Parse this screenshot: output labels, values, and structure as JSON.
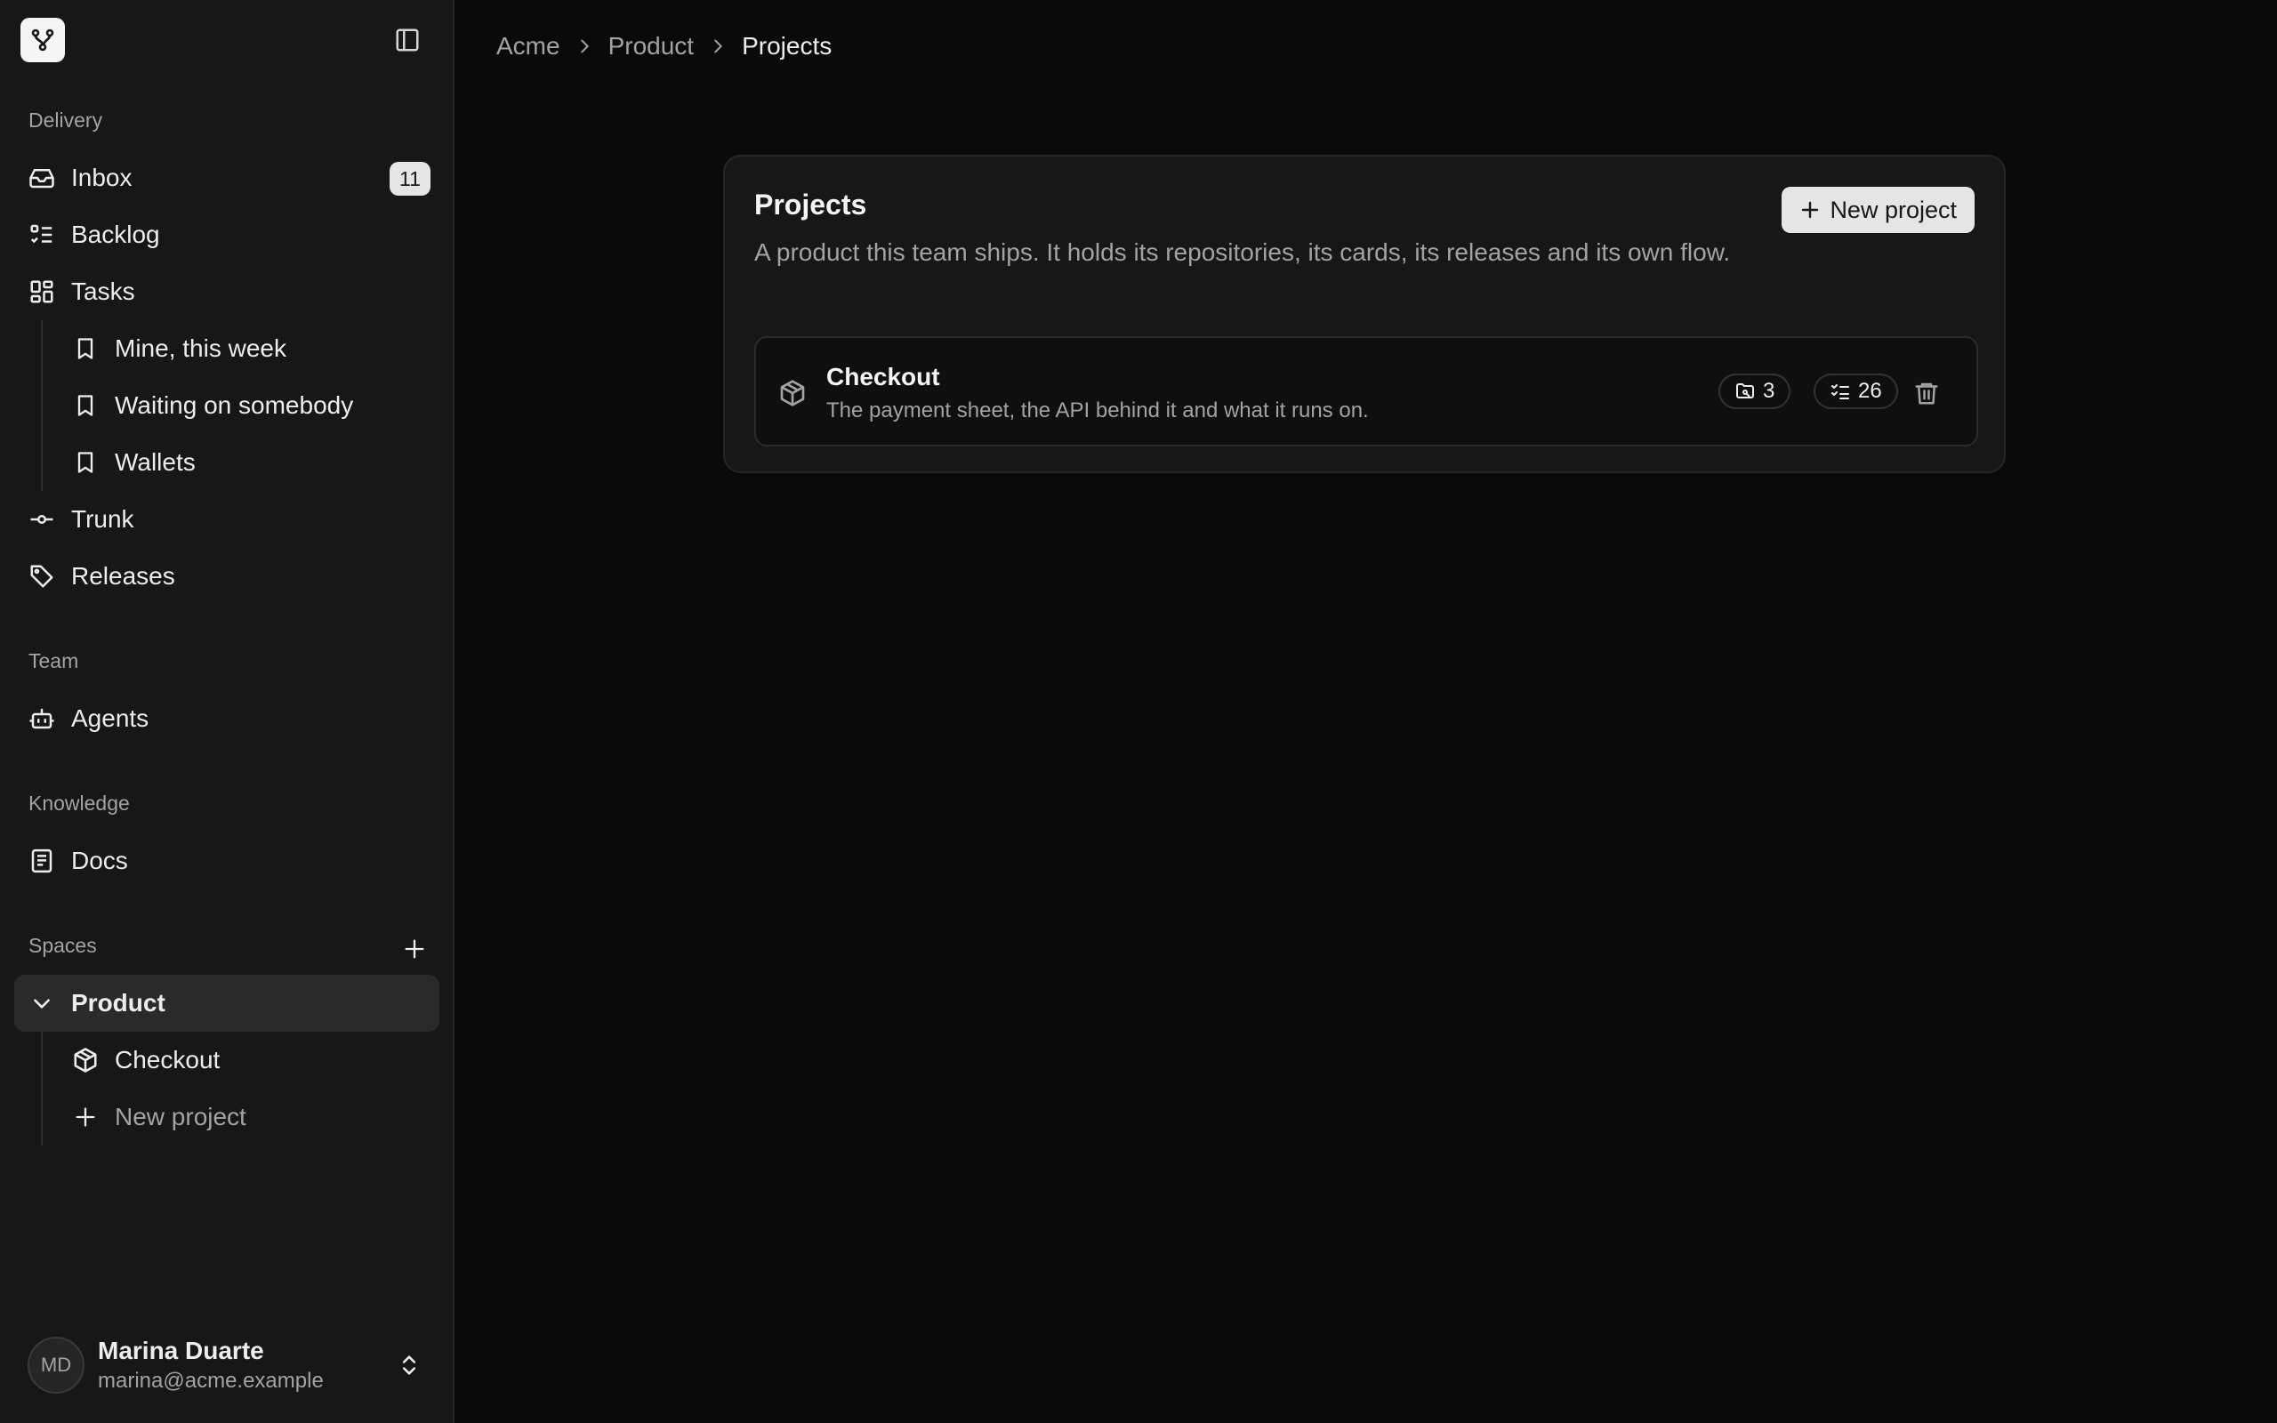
{
  "sidebar": {
    "groups": {
      "delivery": "Delivery",
      "team": "Team",
      "knowledge": "Knowledge",
      "spaces": "Spaces"
    },
    "items": {
      "inbox": {
        "label": "Inbox",
        "badge": "11"
      },
      "backlog": {
        "label": "Backlog"
      },
      "tasks": {
        "label": "Tasks"
      },
      "mine_this_week": {
        "label": "Mine, this week"
      },
      "waiting_on_somebody": {
        "label": "Waiting on somebody"
      },
      "wallets": {
        "label": "Wallets"
      },
      "trunk": {
        "label": "Trunk"
      },
      "releases": {
        "label": "Releases"
      },
      "agents": {
        "label": "Agents"
      },
      "docs": {
        "label": "Docs"
      },
      "product": {
        "label": "Product"
      },
      "checkout": {
        "label": "Checkout"
      },
      "new_project": {
        "label": "New project"
      }
    },
    "user": {
      "initials": "MD",
      "name": "Marina Duarte",
      "email": "marina@acme.example"
    }
  },
  "breadcrumb": {
    "items": [
      "Acme",
      "Product",
      "Projects"
    ]
  },
  "projects_card": {
    "title": "Projects",
    "description": "A product this team ships. It holds its repositories, its cards, its releases and its own flow.",
    "new_button": "New project",
    "rows": [
      {
        "name": "Checkout",
        "description": "The payment sheet, the API behind it and what it runs on.",
        "repos_count": "3",
        "cards_count": "26"
      }
    ]
  },
  "colors": {
    "sidebar_bg": "#171717",
    "main_bg": "#0a0a0a",
    "active_item_bg": "#2a2a2a",
    "button_bg": "#e5e5e5",
    "text_muted": "#a3a3a3"
  },
  "icons": {
    "logo": "git-branch-logo",
    "collapse": "sidebar-panel-icon",
    "inbox": "inbox-icon",
    "backlog": "checklist-icon",
    "tasks": "dashboard-grid-icon",
    "view": "bookmark-icon",
    "trunk": "git-commit-icon",
    "releases": "tag-icon",
    "agents": "bot-icon",
    "docs": "book-icon",
    "chevron": "chevron-down-icon",
    "project": "package-box-icon",
    "add": "plus-icon",
    "repo": "folder-git-icon",
    "cards": "list-checks-icon",
    "delete": "trash-icon",
    "user_menu": "chevrons-up-down-icon"
  }
}
